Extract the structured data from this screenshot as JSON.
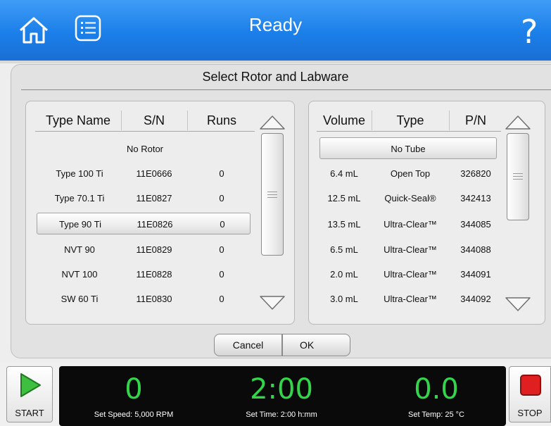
{
  "header": {
    "title": "Ready",
    "icons": {
      "home": "home-icon",
      "menu": "menu-list-icon",
      "help": "help-icon"
    },
    "help_glyph": "?"
  },
  "dialog": {
    "title": "Select Rotor and Labware",
    "rotors": {
      "columns": [
        "Type Name",
        "S/N",
        "Runs"
      ],
      "no_rotor_label": "No Rotor",
      "rows": [
        {
          "type": "Type 100 Ti",
          "sn": "11E0666",
          "runs": "0"
        },
        {
          "type": "Type 70.1 Ti",
          "sn": "11E0827",
          "runs": "0"
        },
        {
          "type": "Type 90 Ti",
          "sn": "11E0826",
          "runs": "0"
        },
        {
          "type": "NVT 90",
          "sn": "11E0829",
          "runs": "0"
        },
        {
          "type": "NVT 100",
          "sn": "11E0828",
          "runs": "0"
        },
        {
          "type": "SW 60 Ti",
          "sn": "11E0830",
          "runs": "0"
        }
      ],
      "selected": "Type 90 Ti"
    },
    "labware": {
      "columns": [
        "Volume",
        "Type",
        "P/N"
      ],
      "no_tube_label": "No Tube",
      "rows": [
        {
          "volume": "6.4 mL",
          "type": "Open Top",
          "pn": "326820"
        },
        {
          "volume": "12.5 mL",
          "type": "Quick-Seal®",
          "pn": "342413"
        },
        {
          "volume": "13.5 mL",
          "type": "Ultra-Clear™",
          "pn": "344085"
        },
        {
          "volume": "6.5 mL",
          "type": "Ultra-Clear™",
          "pn": "344088"
        },
        {
          "volume": "2.0 mL",
          "type": "Ultra-Clear™",
          "pn": "344091"
        },
        {
          "volume": "3.0 mL",
          "type": "Ultra-Clear™",
          "pn": "344092"
        }
      ],
      "selected": "No Tube"
    },
    "cancel_label": "Cancel",
    "ok_label": "OK"
  },
  "run_bar": {
    "start_label": "START",
    "stop_label": "STOP",
    "speed_value": "0",
    "speed_label": "Set Speed: 5,000 RPM",
    "time_value": "2:00",
    "time_label": "Set Time: 2:00 h:mm",
    "temp_value": "0.0",
    "temp_label": "Set Temp: 25 °C",
    "value_color": "#33d64a"
  }
}
